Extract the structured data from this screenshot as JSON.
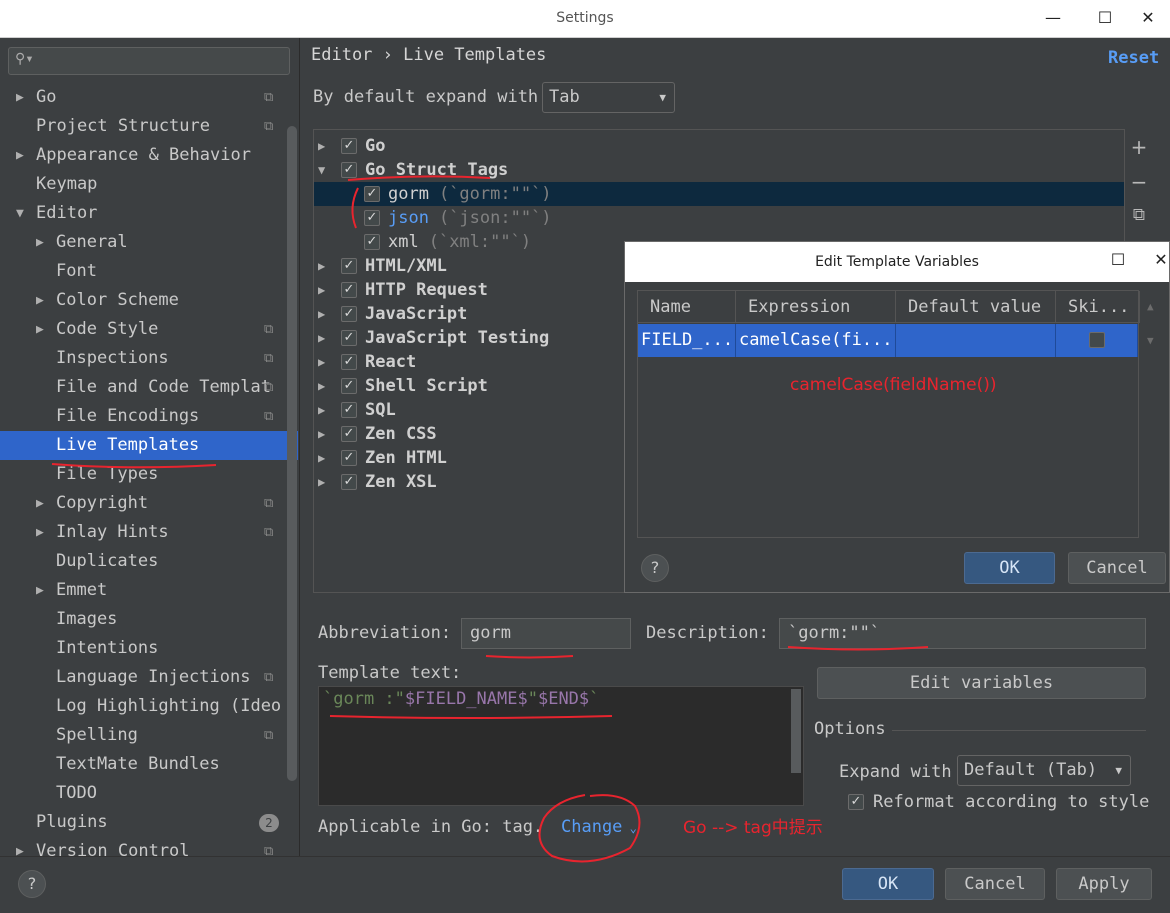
{
  "window": {
    "title": "Settings",
    "minimize": "—",
    "maximize": "☐",
    "close": "✕"
  },
  "sidebar": {
    "items": [
      {
        "label": "Go",
        "arrow": "▶",
        "copy": true
      },
      {
        "label": "Project Structure",
        "arrow": "",
        "copy": true
      },
      {
        "label": "Appearance & Behavior",
        "arrow": "▶",
        "copy": false
      },
      {
        "label": "Keymap",
        "arrow": "",
        "copy": false
      },
      {
        "label": "Editor",
        "arrow": "▼",
        "copy": false
      },
      {
        "label": "General",
        "arrow": "▶",
        "copy": false
      },
      {
        "label": "Font",
        "arrow": "",
        "copy": false
      },
      {
        "label": "Color Scheme",
        "arrow": "▶",
        "copy": false
      },
      {
        "label": "Code Style",
        "arrow": "▶",
        "copy": true
      },
      {
        "label": "Inspections",
        "arrow": "",
        "copy": true
      },
      {
        "label": "File and Code Templat",
        "arrow": "",
        "copy": true
      },
      {
        "label": "File Encodings",
        "arrow": "",
        "copy": true
      },
      {
        "label": "Live Templates",
        "arrow": "",
        "copy": false
      },
      {
        "label": "File Types",
        "arrow": "",
        "copy": false
      },
      {
        "label": "Copyright",
        "arrow": "▶",
        "copy": true
      },
      {
        "label": "Inlay Hints",
        "arrow": "▶",
        "copy": true
      },
      {
        "label": "Duplicates",
        "arrow": "",
        "copy": false
      },
      {
        "label": "Emmet",
        "arrow": "▶",
        "copy": false
      },
      {
        "label": "Images",
        "arrow": "",
        "copy": false
      },
      {
        "label": "Intentions",
        "arrow": "",
        "copy": false
      },
      {
        "label": "Language Injections",
        "arrow": "",
        "copy": true
      },
      {
        "label": "Log Highlighting (Ideo",
        "arrow": "",
        "copy": false
      },
      {
        "label": "Spelling",
        "arrow": "",
        "copy": true
      },
      {
        "label": "TextMate Bundles",
        "arrow": "",
        "copy": false
      },
      {
        "label": "TODO",
        "arrow": "",
        "copy": false
      },
      {
        "label": "Plugins",
        "arrow": "",
        "copy": false,
        "badge": "2"
      },
      {
        "label": "Version Control",
        "arrow": "▶",
        "copy": true
      }
    ],
    "selected": "Live Templates"
  },
  "main": {
    "breadcrumb": "Editor › Live Templates",
    "reset": "Reset",
    "expand_label": "By default expand with",
    "expand_value": "Tab",
    "groups": [
      {
        "label": "Go",
        "arrow": "▶",
        "checked": true
      },
      {
        "label": "Go Struct Tags",
        "arrow": "▼",
        "checked": true
      },
      {
        "label": "gorm",
        "desc": "(`gorm:\"\"`)",
        "checked": true,
        "child": true
      },
      {
        "label": "json",
        "desc": "(`json:\"\"`)",
        "checked": true,
        "child": true
      },
      {
        "label": "xml",
        "desc": "(`xml:\"\"`)",
        "checked": true,
        "child": true
      },
      {
        "label": "HTML/XML",
        "arrow": "▶",
        "checked": true
      },
      {
        "label": "HTTP Request",
        "arrow": "▶",
        "checked": true
      },
      {
        "label": "JavaScript",
        "arrow": "▶",
        "checked": true
      },
      {
        "label": "JavaScript Testing",
        "arrow": "▶",
        "checked": true
      },
      {
        "label": "React",
        "arrow": "▶",
        "checked": true
      },
      {
        "label": "Shell Script",
        "arrow": "▶",
        "checked": true
      },
      {
        "label": "SQL",
        "arrow": "▶",
        "checked": true
      },
      {
        "label": "Zen CSS",
        "arrow": "▶",
        "checked": true
      },
      {
        "label": "Zen HTML",
        "arrow": "▶",
        "checked": true
      },
      {
        "label": "Zen XSL",
        "arrow": "▶",
        "checked": true
      }
    ],
    "tools": {
      "add": "+",
      "remove": "−",
      "copy": "⧉"
    },
    "abbreviation_label": "Abbreviation:",
    "abbreviation_value": "gorm",
    "description_label": "Description:",
    "description_value": "`gorm:\"\"`",
    "template_text_label": "Template text:",
    "template_text": {
      "p1": "`gorm :\"",
      "p2": "$FIELD_NAME$",
      "p3": "\"",
      "p4": "$END$",
      "p5": "`"
    },
    "edit_variables": "Edit variables",
    "options_label": "Options",
    "expand_with_label": "Expand with",
    "expand_with_value": "Default (Tab)",
    "reformat_label": "Reformat according to style",
    "applicable_label": "Applicable in Go: tag.",
    "change_label": "Change"
  },
  "footer": {
    "help": "?",
    "ok": "OK",
    "cancel": "Cancel",
    "apply": "Apply"
  },
  "dialog": {
    "title": "Edit Template Variables",
    "maximize": "☐",
    "close": "✕",
    "columns": [
      "Name",
      "Expression",
      "Default value",
      "Ski..."
    ],
    "row": {
      "name": "FIELD_...",
      "expression": "camelCase(fi...",
      "default": "",
      "skip": false
    },
    "help": "?",
    "ok": "OK",
    "cancel": "Cancel"
  },
  "annotations": {
    "camel": "camelCase(fieldName())",
    "go_tag": "Go --> tag中提示"
  },
  "colors": {
    "selection": "#2f65ca",
    "link": "#589df6",
    "annotation": "#e8242e",
    "background": "#3c3f41"
  }
}
